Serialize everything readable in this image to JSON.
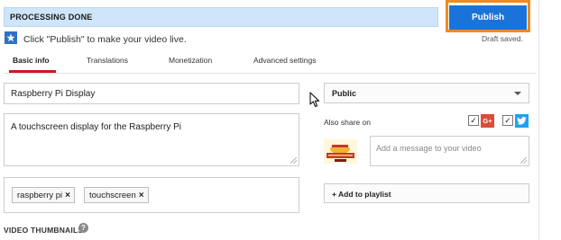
{
  "status": {
    "text": "PROCESSING DONE"
  },
  "publish": {
    "label": "Publish",
    "highlight_color": "#f08a24",
    "button_color": "#1a73d9"
  },
  "hint": {
    "text": "Click \"Publish\" to make your video live.",
    "icon": "star-icon"
  },
  "draft_status": "Draft saved.",
  "tabs": [
    {
      "label": "Basic info",
      "active": true
    },
    {
      "label": "Translations",
      "active": false
    },
    {
      "label": "Monetization",
      "active": false
    },
    {
      "label": "Advanced settings",
      "active": false
    }
  ],
  "accent_color": "#cc181e",
  "title": {
    "value": "Raspberry Pi Display"
  },
  "description": {
    "value": "A touchscreen display for the Raspberry Pi"
  },
  "tags": [
    {
      "label": "raspberry pi",
      "remove": "×"
    },
    {
      "label": "touchscreen",
      "remove": "×"
    }
  ],
  "thumbnails": {
    "label": "VIDEO THUMBNAILS",
    "help_icon": "question-icon",
    "help_glyph": "?"
  },
  "privacy": {
    "selected": "Public"
  },
  "share": {
    "label": "Also share on",
    "networks": [
      {
        "name": "google-plus",
        "glyph": "G+",
        "checked": true,
        "color": "#dd4b39"
      },
      {
        "name": "twitter",
        "checked": true,
        "color": "#1da1f2"
      }
    ],
    "message_placeholder": "Add a message to your video"
  },
  "playlist": {
    "label": "+ Add to playlist"
  }
}
